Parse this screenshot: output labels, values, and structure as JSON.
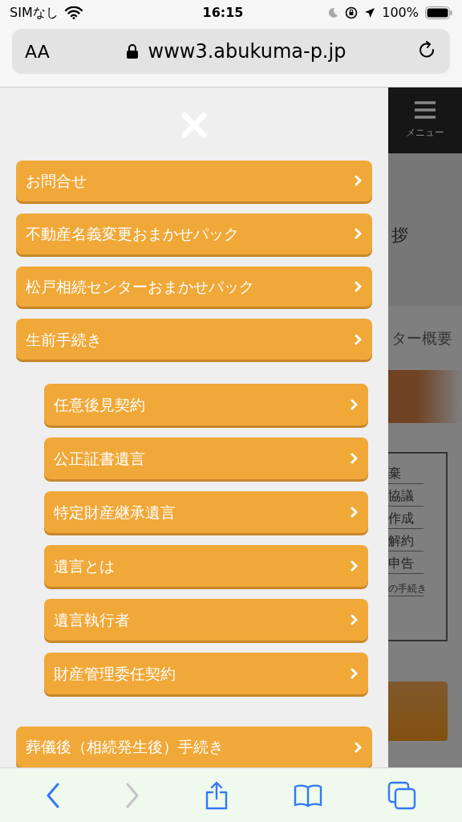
{
  "status_bar": {
    "carrier": "SIMなし",
    "time": "16:15",
    "battery": "100%"
  },
  "url_bar": {
    "text_size": "AA",
    "domain": "www3.abukuma-p.jp"
  },
  "menu": {
    "items": [
      {
        "label": "お問合せ"
      },
      {
        "label": "不動産名義変更おまかせパック"
      },
      {
        "label": "松戸相続センターおまかせパック"
      },
      {
        "label": "生前手続き",
        "children": [
          {
            "label": "任意後見契約"
          },
          {
            "label": "公正証書遺言"
          },
          {
            "label": "特定財産継承遺言"
          },
          {
            "label": "遺言とは"
          },
          {
            "label": "遺言執行者"
          },
          {
            "label": "財産管理委任契約"
          }
        ]
      },
      {
        "label": "葬儀後（相続発生後）手続き"
      }
    ]
  },
  "page_behind": {
    "menu_label": "メニュー",
    "greeting": "拶",
    "section_title": "ター概要",
    "note_items": [
      "棄",
      "協議",
      "作成",
      "解約",
      "申告",
      "の手続き"
    ]
  },
  "toolbar": {
    "back_disabled": false,
    "forward_disabled": true
  }
}
